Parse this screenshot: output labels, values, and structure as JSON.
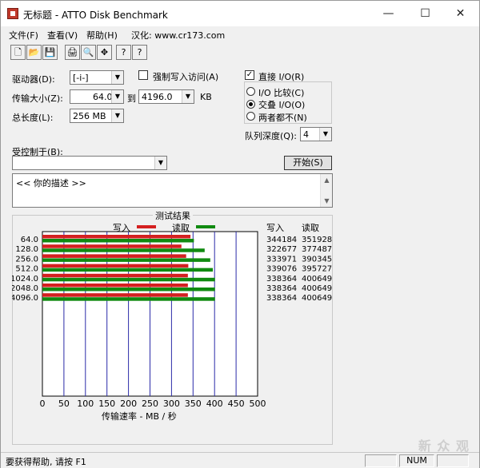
{
  "window": {
    "title": "无标题 - ATTO Disk Benchmark",
    "minimize": "—",
    "maximize": "☐",
    "close": "✕"
  },
  "menu": [
    "文件(F)",
    "查看(V)",
    "帮助(H)",
    "汉化: www.cr173.com"
  ],
  "toolbar": {
    "icons": [
      "new-icon",
      "open-icon",
      "save-icon",
      "print-icon",
      "print-preview-icon",
      "crosshair-icon",
      "info-icon",
      "help-pointer-icon"
    ],
    "glyphs": [
      "🗋",
      "📂",
      "💾",
      "🖨",
      "🔍",
      "✥",
      "?",
      "?"
    ]
  },
  "form": {
    "drive_label": "驱动器(D):",
    "drive_value": "[-i-]",
    "force_write_label": "强制写入访问(A)",
    "transfer_label": "传输大小(Z):",
    "transfer_from": "64.0",
    "to_label": "到",
    "transfer_to": "4196.0",
    "unit": "KB",
    "total_label": "总长度(L):",
    "total_value": "256 MB",
    "direct_io_label": "直接 I/O(R)",
    "direct_io_checked": true,
    "io_compare_label": "I/O 比较(C)",
    "overlap_label": "交叠 I/O(O)",
    "neither_label": "两者都不(N)",
    "selected_io_mode": "overlap",
    "queue_label": "队列深度(Q):",
    "queue_value": "4",
    "controlled_by_label": "受控制于(B):",
    "controlled_by_value": "",
    "start_button": "开始(S)",
    "description": "<< 你的描述 >>"
  },
  "results": {
    "title": "测试结果",
    "write_legend": "写入",
    "read_legend": "读取",
    "write_header": "写入",
    "read_header": "读取",
    "axis_label": "传输速率 - MB / 秒"
  },
  "chart_data": {
    "type": "bar",
    "orientation": "horizontal",
    "title": "测试结果",
    "xlabel": "传输速率 - MB / 秒",
    "ylabel": "",
    "categories": [
      "64.0",
      "128.0",
      "256.0",
      "512.0",
      "1024.0",
      "2048.0",
      "4096.0"
    ],
    "series": [
      {
        "name": "写入",
        "color": "#d42020",
        "values": [
          344184,
          322677,
          333971,
          339076,
          338364,
          338364,
          338364
        ]
      },
      {
        "name": "读取",
        "color": "#108a10",
        "values": [
          351928,
          377487,
          390345,
          395727,
          400649,
          400649,
          400649
        ]
      }
    ],
    "bar_lengths_mb": {
      "写入": [
        344,
        323,
        334,
        339,
        338,
        338,
        338
      ],
      "读取": [
        352,
        377,
        390,
        396,
        401,
        401,
        401
      ]
    },
    "xticks": [
      0,
      50,
      100,
      150,
      200,
      250,
      300,
      350,
      400,
      450,
      500
    ],
    "xlim": [
      0,
      500
    ],
    "grid": true,
    "legend_position": "top"
  },
  "status": {
    "help_text": "要获得帮助, 请按 F1",
    "num": "NUM"
  },
  "watermark": "新 众 观"
}
